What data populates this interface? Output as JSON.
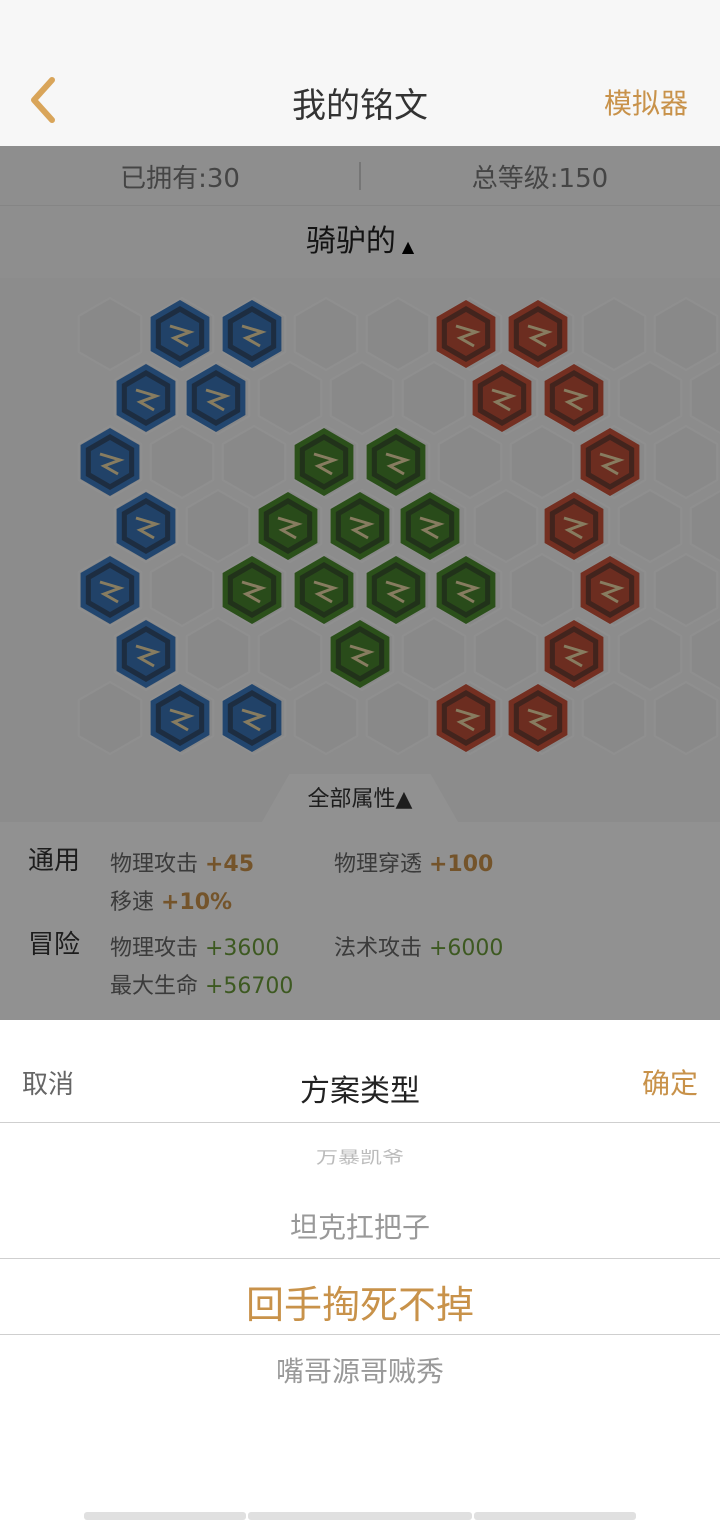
{
  "header": {
    "title": "我的铭文",
    "action_label": "模拟器",
    "back_icon": "chevron-left-icon"
  },
  "stats": {
    "owned": "已拥有:30",
    "total_level": "总等级:150"
  },
  "plan": {
    "name": "骑驴的",
    "caret": "▲"
  },
  "board": {
    "colors": {
      "blue": "#3b79c0",
      "red": "#c8523a",
      "green": "#4b8a2e"
    },
    "rune_groups": [
      "blue-rune",
      "green-rune",
      "red-rune"
    ]
  },
  "attributes": {
    "tab_label": "全部属性▲",
    "general": {
      "label": "通用",
      "items": [
        {
          "name": "物理攻击 ",
          "value": "+45"
        },
        {
          "name": "物理穿透 ",
          "value": "+100"
        },
        {
          "name": "移速 ",
          "value": "+10%"
        }
      ]
    },
    "adventure": {
      "label": "冒险",
      "items": [
        {
          "name": "物理攻击 ",
          "value": "+3600"
        },
        {
          "name": "法术攻击 ",
          "value": "+6000"
        },
        {
          "name": "最大生命 ",
          "value": "+56700"
        }
      ]
    }
  },
  "sheet": {
    "cancel": "取消",
    "title": "方案类型",
    "confirm": "确定",
    "options": [
      "万暴凯爷",
      "坦克扛把子",
      "回手掏死不掉",
      "嘴哥源哥贼秀"
    ],
    "selected": "回手掏死不掉"
  }
}
